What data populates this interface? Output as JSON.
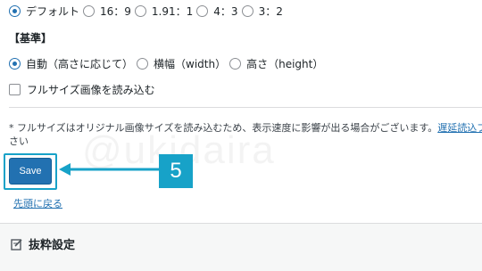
{
  "aspect": {
    "options": [
      "デフォルト",
      "16：9",
      "1.91：1",
      "4：3",
      "3：2"
    ],
    "selected": "デフォルト"
  },
  "basis": {
    "heading": "【基準】",
    "options": [
      "自動（高さに応じて）",
      "横幅（width）",
      "高さ（height）"
    ],
    "selected": "自動（高さに応じて）"
  },
  "fullsize": {
    "label": "フルサイズ画像を読み込む",
    "checked": false
  },
  "note": {
    "text": "* フルサイズはオリジナル画像サイズを読み込むため、表示速度に影響が出る場合がございます。",
    "link_text": "遅延読込プ",
    "continuation": "さい"
  },
  "save_button": {
    "label": "Save"
  },
  "annotation": {
    "step_number": "5",
    "color": "#17a2c8"
  },
  "back_to_top": {
    "label": "先頭に戻る"
  },
  "section": {
    "title": "抜粋設定",
    "icon": "edit-icon"
  },
  "watermark": "@ukidaira",
  "colors": {
    "primary": "#2271b1",
    "accent": "#17a2c8",
    "text": "#1d2327"
  }
}
